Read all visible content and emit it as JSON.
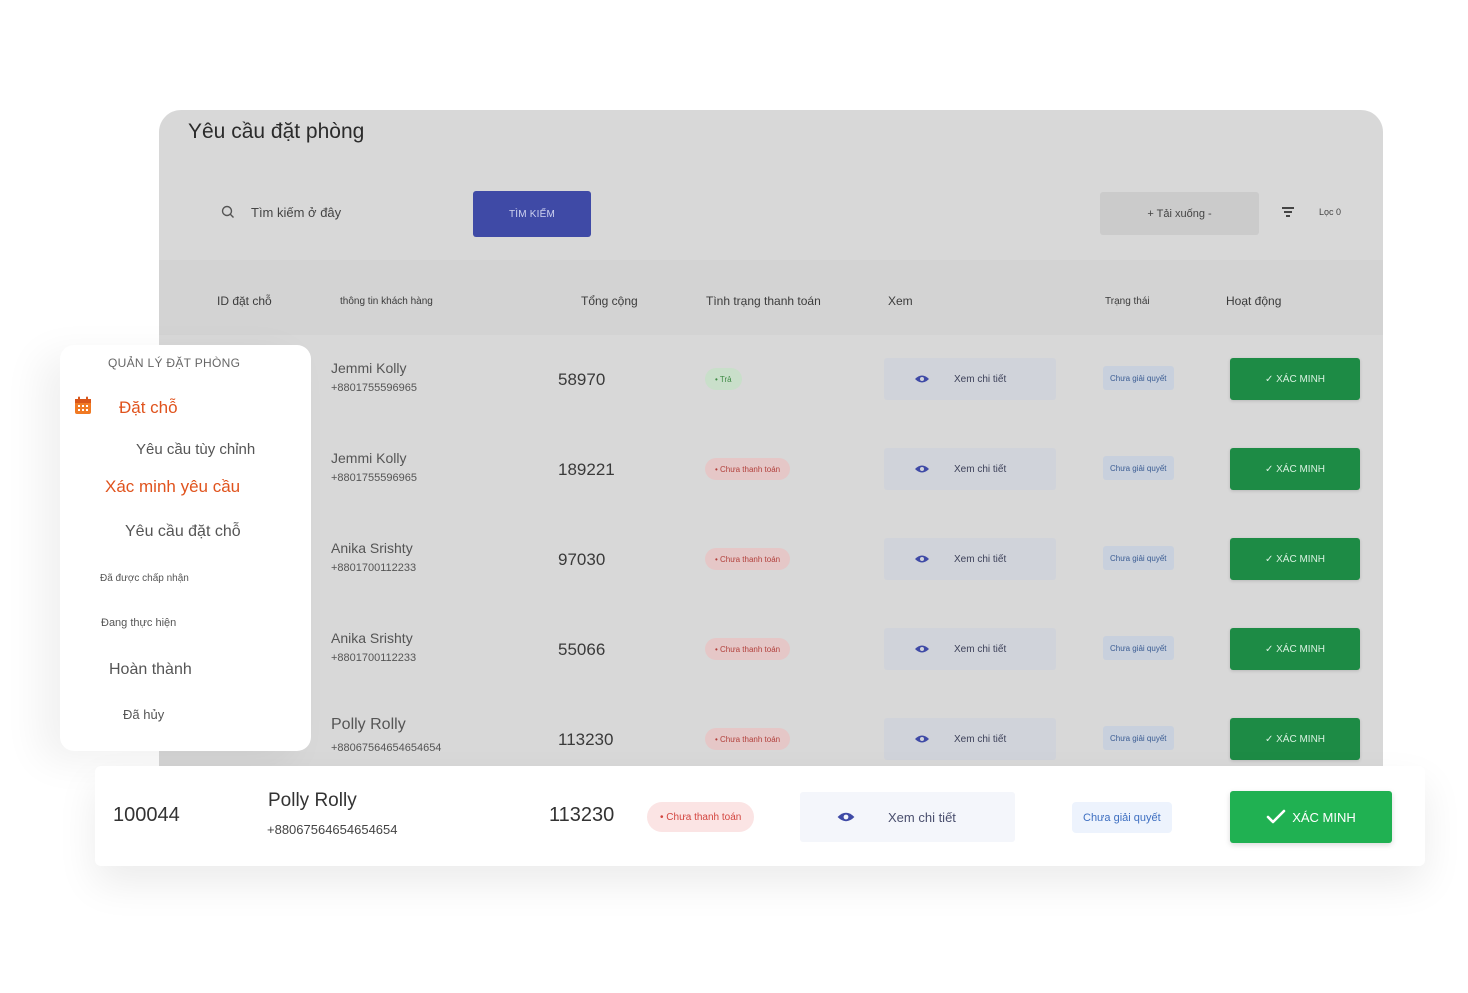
{
  "page": {
    "title": "Yêu cầu đặt phòng"
  },
  "toolbar": {
    "search_placeholder": "Tìm kiếm ở đây",
    "search_button": "TÌM KIẾM",
    "download_button": "+ Tải xuống -",
    "filter_label": "Lọc 0"
  },
  "table": {
    "headers": {
      "id": "ID đặt chỗ",
      "customer": "thông tin khách hàng",
      "total": "Tổng cộng",
      "payment_status": "Tình trạng thanh toán",
      "view": "Xem",
      "status": "Trạng thái",
      "action": "Hoạt động"
    },
    "view_label": "Xem chi tiết",
    "verify_label": "✓ XÁC MINH",
    "rows": [
      {
        "name": "Jemmi Kolly",
        "phone": "+8801755596965",
        "total": "58970",
        "payment": "• Trả",
        "status": "Chưa giải quyết"
      },
      {
        "name": "Jemmi Kolly",
        "phone": "+8801755596965",
        "total": "189221",
        "payment": "• Chưa thanh toán",
        "status": "Chưa giải quyết"
      },
      {
        "name": "Anika Srishty",
        "phone": "+8801700112233",
        "total": "97030",
        "payment": "• Chưa thanh toán",
        "status": "Chưa giải quyết"
      },
      {
        "name": "Anika Srishty",
        "phone": "+8801700112233",
        "total": "55066",
        "payment": "• Chưa thanh toán",
        "status": "Chưa giải quyết"
      },
      {
        "name": "Polly Rolly",
        "phone": "+88067564654654654",
        "total": "113230",
        "payment": "• Chưa thanh toán",
        "status": "Chưa giải quyết"
      }
    ]
  },
  "sidebar": {
    "title": "QUẢN LÝ ĐẶT PHÒNG",
    "section": "Đặt chỗ",
    "items": [
      "Yêu cầu tùy chỉnh",
      "Xác minh yêu cầu",
      "Yêu cầu đặt chỗ",
      "Đã được chấp nhận",
      "Đang thực hiện",
      "Hoàn thành",
      "Đã hủy"
    ],
    "accent_color": "#e0531d"
  },
  "highlight_row": {
    "id": "100044",
    "name": "Polly Rolly",
    "phone": "+88067564654654654",
    "total": "113230",
    "payment": "• Chưa thanh toán",
    "view": "Xem chi tiết",
    "status": "Chưa giải quyết",
    "verify": "XÁC MINH"
  },
  "colors": {
    "primary_button": "#3f4aa6",
    "verify_green": "#20b152",
    "unpaid_red": "#d3453f",
    "pending_blue": "#3e6fc1"
  }
}
